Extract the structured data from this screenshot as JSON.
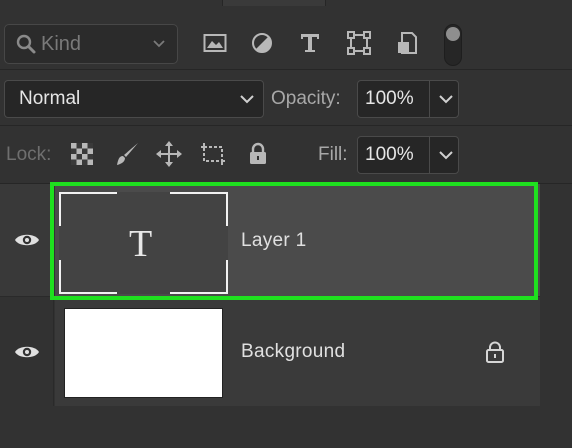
{
  "filter": {
    "kind_placeholder": "Kind"
  },
  "filter_icons": [
    "image-filter-icon",
    "adjustment-filter-icon",
    "type-filter-icon",
    "shape-filter-icon",
    "smart-object-filter-icon"
  ],
  "blend": {
    "mode": "Normal"
  },
  "opacity": {
    "label": "Opacity:",
    "value": "100%"
  },
  "lock": {
    "label": "Lock:"
  },
  "fill": {
    "label": "Fill:",
    "value": "100%"
  },
  "layers": [
    {
      "name": "Layer 1",
      "type": "text",
      "visible": true,
      "selected": true,
      "thumb_glyph": "T"
    },
    {
      "name": "Background",
      "type": "pixel",
      "visible": true,
      "selected": false,
      "locked": true
    }
  ],
  "colors": {
    "panel": "#323232",
    "selected_layer": "#4b4b4b",
    "highlight": "#1fe01f"
  }
}
